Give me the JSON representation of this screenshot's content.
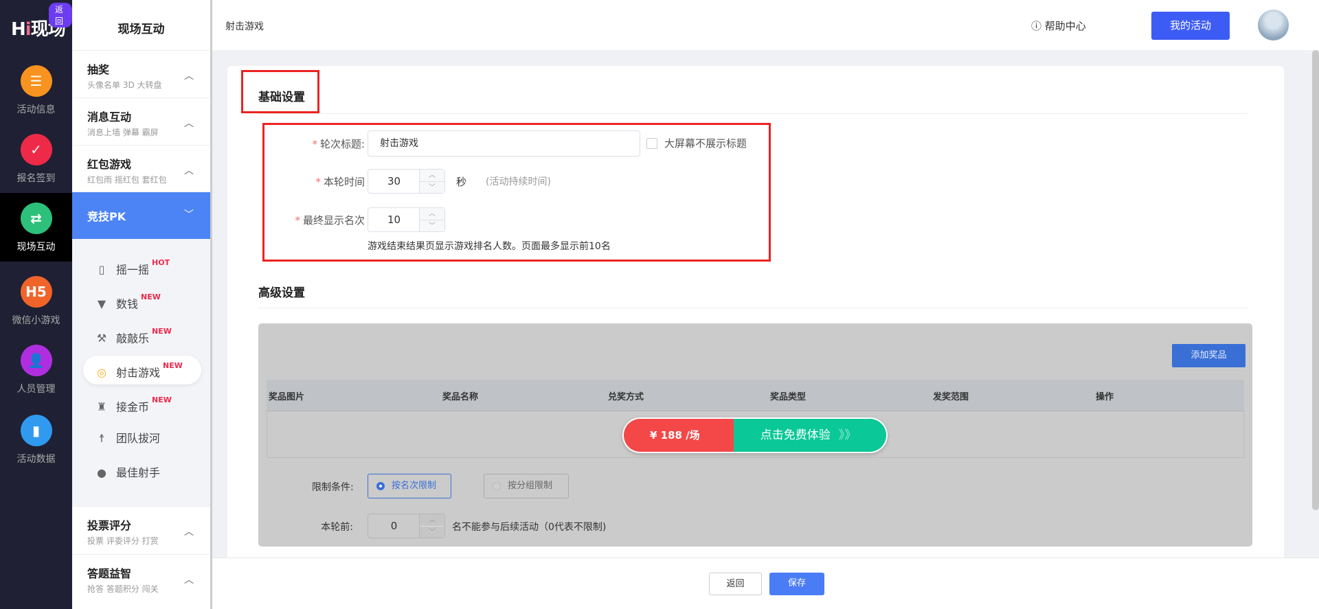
{
  "rail": {
    "logo": "Hi现场",
    "back": "返回",
    "items": [
      {
        "label": "活动信息",
        "icon": "document-icon",
        "color": "#f7931e"
      },
      {
        "label": "报名签到",
        "icon": "calendar-check-icon",
        "color": "#ee2a48"
      },
      {
        "label": "现场互动",
        "icon": "interaction-icon",
        "color": "#2cc07a",
        "active": true
      },
      {
        "label": "微信小游戏",
        "icon": "h5-icon",
        "color": "#f0642a",
        "text": "H5"
      },
      {
        "label": "人员管理",
        "icon": "person-card-icon",
        "color": "#b02ee0"
      },
      {
        "label": "活动数据",
        "icon": "bar-chart-icon",
        "color": "#2f9af0"
      }
    ]
  },
  "side": {
    "title": "现场互动",
    "sections": [
      {
        "title": "抽奖",
        "sub": "头像名单 3D 大转盘"
      },
      {
        "title": "消息互动",
        "sub": "消息上墙 弹幕 霸屏"
      },
      {
        "title": "红包游戏",
        "sub": "红包雨 摇红包 套红包"
      },
      {
        "title": "竞技PK",
        "sub": ""
      },
      {
        "title": "投票评分",
        "sub": "投票 评委评分 打赏"
      },
      {
        "title": "答题益智",
        "sub": "抢答 答题积分 闯关"
      }
    ],
    "games": [
      {
        "label": "摇一摇",
        "badge": "HOT",
        "icon": "phone-shake-icon"
      },
      {
        "label": "数钱",
        "badge": "NEW",
        "icon": "money-icon"
      },
      {
        "label": "敲敲乐",
        "badge": "NEW",
        "icon": "hammer-icon"
      },
      {
        "label": "射击游戏",
        "badge": "NEW",
        "icon": "target-icon",
        "active": true
      },
      {
        "label": "接金币",
        "badge": "NEW",
        "icon": "coin-catch-icon"
      },
      {
        "label": "团队拔河",
        "badge": "",
        "icon": "tug-of-war-icon"
      },
      {
        "label": "最佳射手",
        "badge": "",
        "icon": "ball-icon"
      }
    ]
  },
  "header": {
    "breadcrumb": "射击游戏",
    "help": "帮助中心",
    "my_activity": "我的活动"
  },
  "basic": {
    "title": "基础设置",
    "round_title_label": "轮次标题:",
    "round_title_value": "射击游戏",
    "hide_title_label": "大屏幕不展示标题",
    "time_label": "本轮时间",
    "time_value": "30",
    "time_unit": "秒",
    "time_hint": "(活动持续时间)",
    "rank_label": "最终显示名次",
    "rank_value": "10",
    "rank_hint": "游戏结束结果页显示游戏排名人数。页面最多显示前10名"
  },
  "advanced": {
    "title": "高级设置",
    "add_prize": "添加奖品",
    "columns": [
      "奖品图片",
      "奖品名称",
      "兑奖方式",
      "奖品类型",
      "发奖范围",
      "操作"
    ],
    "promo_price": "¥ 188 /场",
    "promo_cta": "点击免费体验",
    "promo_arrows": "》》",
    "limit_label": "限制条件:",
    "limit_options": [
      "按名次限制",
      "按分组限制"
    ],
    "limit_selected": "按名次限制",
    "before_label": "本轮前:",
    "before_value": "0",
    "before_hint": "名不能参与后续活动（0代表不限制)"
  },
  "footer": {
    "back": "返回",
    "save": "保存"
  },
  "colors": {
    "primary": "#3d5cf5",
    "sidebar_active": "#4c84f5",
    "highlight_box": "#ee2222"
  }
}
